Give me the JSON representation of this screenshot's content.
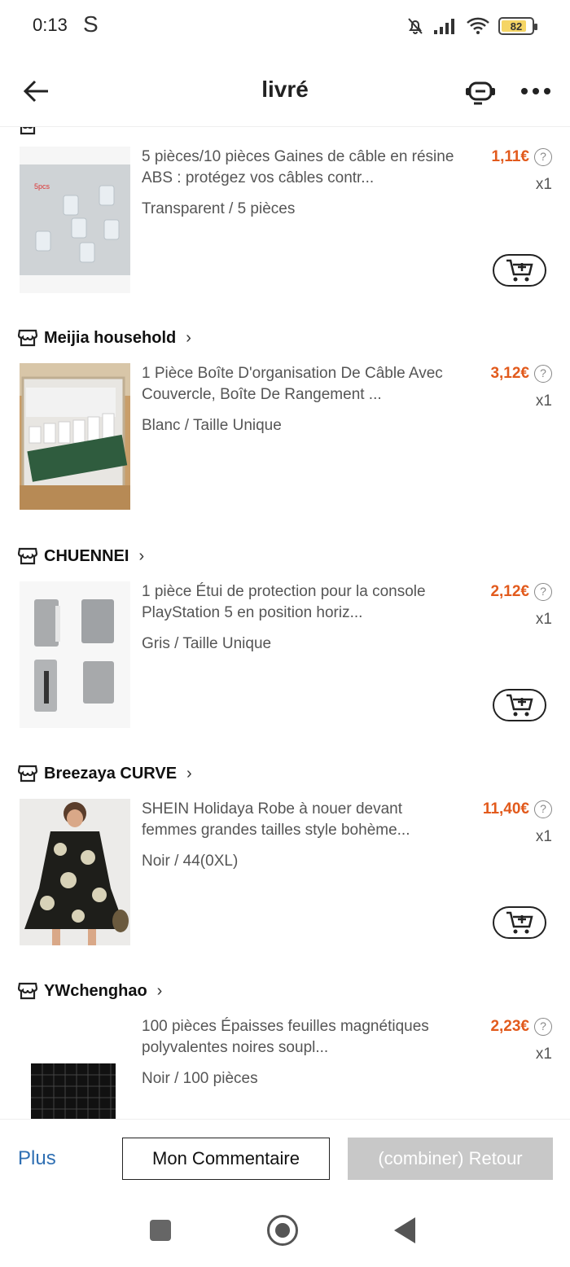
{
  "status_bar": {
    "time": "0:13",
    "carrier_icon": "S",
    "battery": "82",
    "battery_level_pct": 82,
    "icons": [
      "mute-bell-icon",
      "signal-icon",
      "wifi-icon",
      "battery-icon"
    ]
  },
  "header": {
    "title": "livré",
    "back_icon": "arrow-left-icon",
    "support_icon": "support-robot-icon",
    "more_icon": "more-dots-icon"
  },
  "shops": [
    {
      "name": "",
      "item": {
        "title": "5 pièces/10 pièces Gaines de câble en résine ABS : protégez vos câbles contr...",
        "variant": "Transparent / 5 pièces",
        "price": "1,11€",
        "qty": "x1",
        "has_cart_button": true
      }
    },
    {
      "name": "Meijia household",
      "item": {
        "title": "1 Pièce Boîte D'organisation De Câble Avec Couvercle, Boîte De Rangement ...",
        "variant": "Blanc / Taille Unique",
        "price": "3,12€",
        "qty": "x1",
        "has_cart_button": false
      }
    },
    {
      "name": "CHUENNEI",
      "item": {
        "title": "1 pièce Étui de protection pour la console PlayStation 5 en position horiz...",
        "variant": "Gris / Taille Unique",
        "price": "2,12€",
        "qty": "x1",
        "has_cart_button": true
      }
    },
    {
      "name": "Breezaya CURVE",
      "item": {
        "title": "SHEIN Holidaya Robe à nouer devant femmes grandes tailles style bohème...",
        "variant": "Noir / 44(0XL)",
        "price": "11,40€",
        "qty": "x1",
        "has_cart_button": true
      }
    },
    {
      "name": "YWchenghao",
      "item": {
        "title": "100 pièces Épaisses feuilles magnétiques polyvalentes noires soupl...",
        "variant": "Noir / 100 pièces",
        "price": "2,23€",
        "qty": "x1",
        "has_cart_button": false
      }
    }
  ],
  "action_bar": {
    "more_label": "Plus",
    "comment_label": "Mon Commentaire",
    "return_label": "(combiner) Retour"
  },
  "colors": {
    "price": "#e25a1c",
    "link": "#2f6fb3",
    "disabled_button": "#c8c8c8"
  }
}
